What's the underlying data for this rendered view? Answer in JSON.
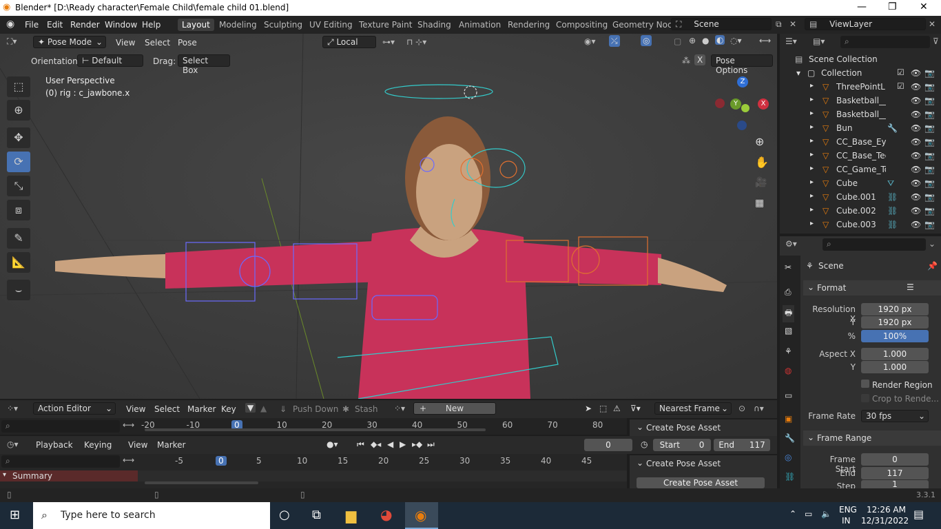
{
  "window": {
    "title": "Blender* [D:\\Ready character\\Female Child\\female child 01.blend]"
  },
  "menu": {
    "items": [
      "File",
      "Edit",
      "Render",
      "Window",
      "Help"
    ]
  },
  "workspaces": [
    "Layout",
    "Modeling",
    "Sculpting",
    "UV Editing",
    "Texture Paint",
    "Shading",
    "Animation",
    "Rendering",
    "Compositing",
    "Geometry Noc"
  ],
  "scene": {
    "label": "Scene",
    "view_layer": "ViewLayer"
  },
  "viewport": {
    "mode": "Pose Mode",
    "menus": [
      "View",
      "Select",
      "Pose"
    ],
    "transform_space": "Local",
    "orientation_label": "Orientation:",
    "orientation_value": "Default",
    "drag_label": "Drag:",
    "drag_value": "Select Box",
    "pose_options": "Pose Options",
    "overlay_title": "User Perspective",
    "overlay_sub": "(0) rig : c_jawbone.x",
    "gizmo": {
      "z": "Z",
      "y": "Y",
      "x": "X"
    }
  },
  "outliner": {
    "root": "Scene Collection",
    "collection": "Collection",
    "items": [
      "ThreePointLight",
      "Basketball__Sh",
      "Basketball__Sh",
      "Bun",
      "CC_Base_Eye",
      "CC_Base_Teeth",
      "CC_Game_Tongu",
      "Cube",
      "Cube.001",
      "Cube.002",
      "Cube.003"
    ]
  },
  "properties": {
    "context": "Scene",
    "format_title": "Format",
    "res_x_label": "Resolution X",
    "res_x": "1920 px",
    "res_y_label": "Y",
    "res_y": "1920 px",
    "pct_label": "%",
    "pct": "100%",
    "aspect_x_label": "Aspect X",
    "aspect_x": "1.000",
    "aspect_y_label": "Y",
    "aspect_y": "1.000",
    "render_region": "Render Region",
    "crop": "Crop to Rende...",
    "frame_rate_label": "Frame Rate",
    "frame_rate": "30 fps",
    "frame_range_title": "Frame Range",
    "frame_start_label": "Frame Start",
    "frame_start": "0",
    "end_label": "End",
    "end": "117",
    "step_label": "Step",
    "step": "1"
  },
  "action_editor": {
    "mode": "Action Editor",
    "menus": [
      "View",
      "Select",
      "Marker",
      "Key"
    ],
    "push_down": "Push Down",
    "stash": "Stash",
    "new": "New",
    "snap": "Nearest Frame",
    "ruler": [
      "-20",
      "-10",
      "0",
      "10",
      "20",
      "30",
      "40",
      "50",
      "60",
      "70",
      "80"
    ],
    "panel_title": "Create Pose Asset"
  },
  "timeline": {
    "menus": [
      "Playback",
      "Keying",
      "View",
      "Marker"
    ],
    "current_frame": "0",
    "start_label": "Start",
    "start": "0",
    "end_label": "End",
    "end": "117",
    "ruler": [
      "-5",
      "0",
      "5",
      "10",
      "15",
      "20",
      "25",
      "30",
      "35",
      "40",
      "45"
    ],
    "summary": "Summary",
    "panel_title": "Create Pose Asset",
    "panel_button": "Create Pose Asset"
  },
  "status": {
    "version": "3.3.1"
  },
  "taskbar": {
    "search_placeholder": "Type here to search",
    "lang1": "ENG",
    "lang2": "IN",
    "time": "12:26 AM",
    "date": "12/31/2022"
  },
  "colors": {
    "accent": "#4772b3",
    "shirt": "#c8325a",
    "summary": "#5a2a2a"
  }
}
